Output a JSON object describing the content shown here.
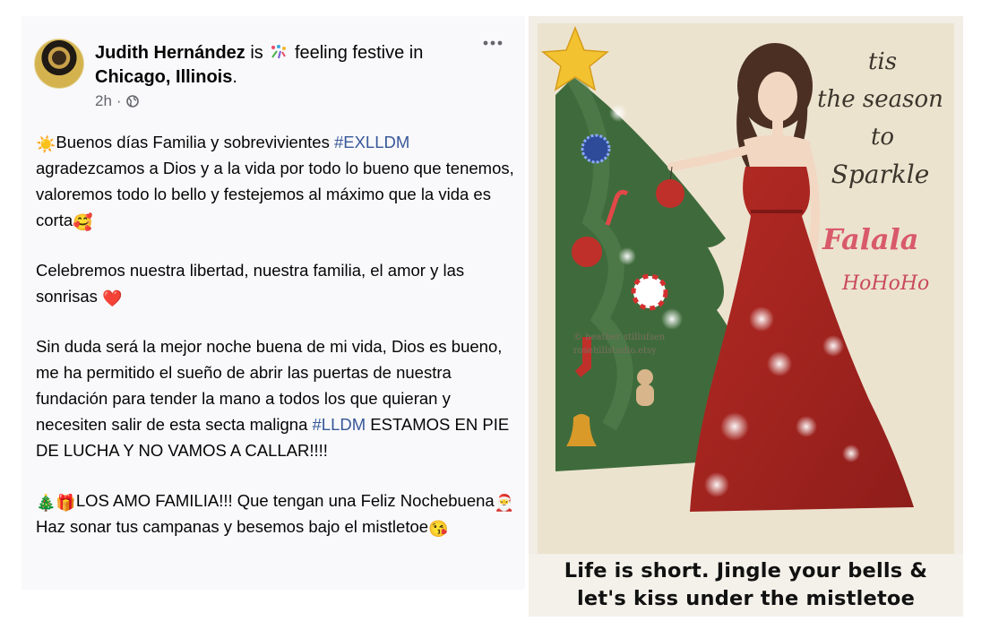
{
  "post": {
    "author": "Judith Hernández",
    "is_text": "is",
    "feeling_text": "feeling festive in",
    "location": "Chicago, Illinois",
    "location_suffix": ".",
    "time": "2h",
    "separator": "·",
    "more_icon": "more-horizontal-icon",
    "privacy_icon": "globe-icon",
    "feeling_icon": "confetti-icon",
    "body": {
      "p1_emoji": "☀️",
      "p1_text": "Buenos días Familia y sobrevivientes ",
      "p1_hashtag": "#EXLLDM",
      "p1_text2": " agradezcamos a Dios y a la vida por todo lo bueno que tenemos, valoremos todo lo bello y festejemos al máximo que la vida es corta",
      "p1_emoji_end": "🥰",
      "p2_text": "Celebremos nuestra libertad, nuestra familia, el amor y las sonrisas ",
      "p2_emoji": "❤️",
      "p3_text": "Sin duda será la mejor noche buena de mi vida, Dios es bueno, me ha permitido el sueño de abrir las puertas de nuestra fundación para tender la mano a todos los que quieran y necesiten salir de esta secta maligna ",
      "p3_hashtag": "#LLDM",
      "p3_text2": " ESTAMOS EN PIE DE LUCHA Y NO VAMOS A CALLAR!!!!",
      "p4_emoji1": "🎄",
      "p4_emoji2": "🎁",
      "p4_text": "LOS AMO FAMILIA!!! Que tengan una Feliz Nochebuena",
      "p4_emoji3": "🎅",
      "p4_text2": " Haz sonar tus campanas y besemos bajo el mistletoe",
      "p4_emoji4": "😘"
    }
  },
  "image": {
    "script_line1": "tis",
    "script_line2": "the season",
    "script_line3": "to",
    "script_line4": "Sparkle",
    "falala": "Falala",
    "hohoho": "HoHoHo",
    "watermark_line1": "© heather stillufsen",
    "watermark_line2": "rosehillstudio.etsy",
    "caption_line1": "Life is short. Jingle your bells &",
    "caption_line2": "let's kiss under the mistletoe"
  },
  "colors": {
    "hashtag": "#385898",
    "dress": "#a8231f",
    "tree": "#3f6b3c",
    "star": "#f2c230"
  }
}
